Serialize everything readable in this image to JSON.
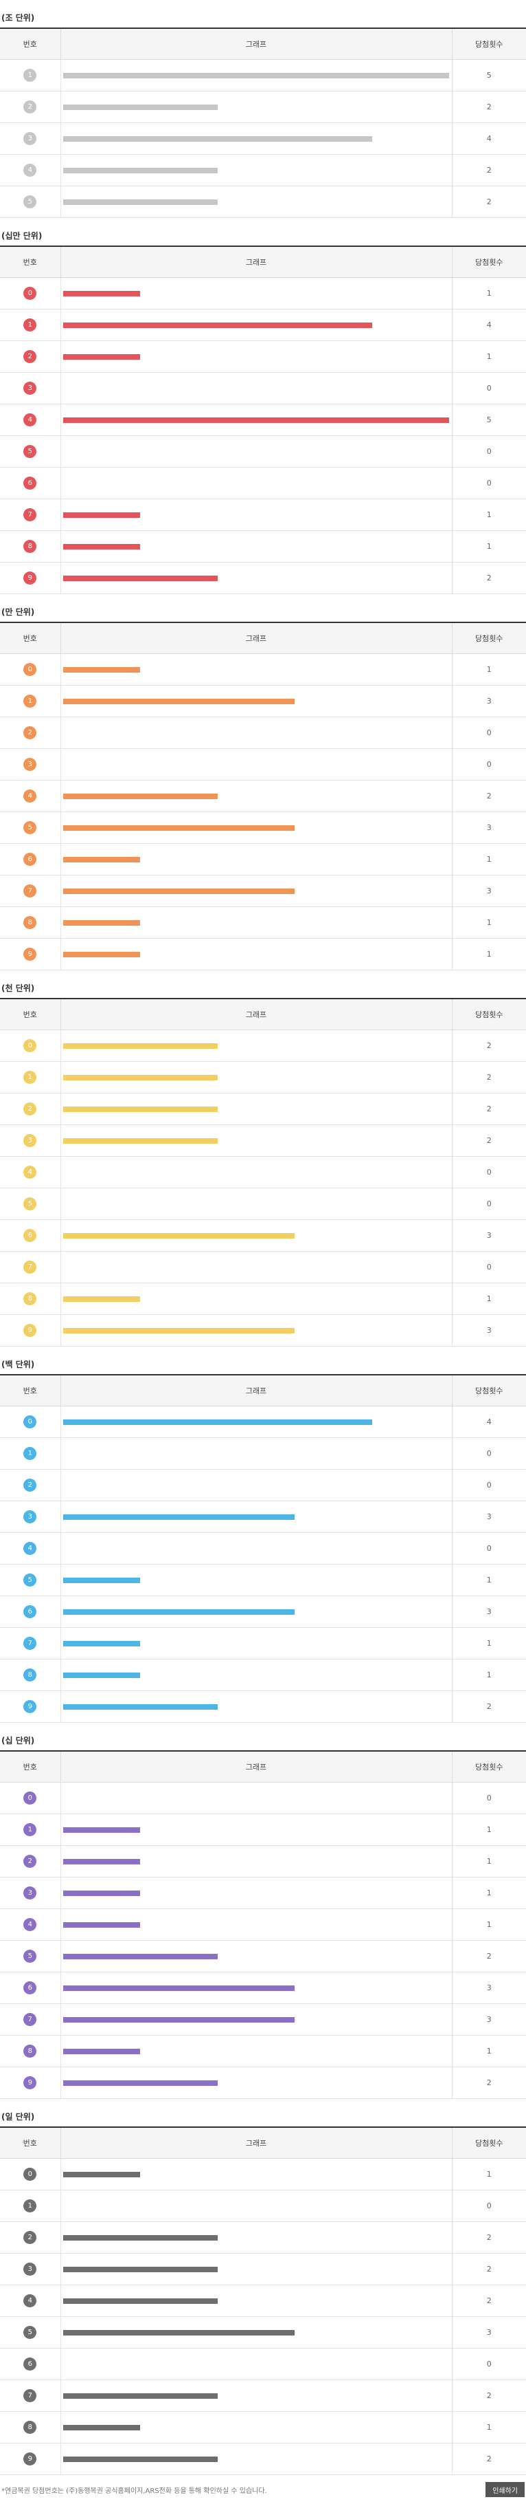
{
  "headers": {
    "number": "번호",
    "graph": "그래프",
    "count": "당첨횟수"
  },
  "max_count": 5,
  "sections": [
    {
      "title": "(조 단위)",
      "color": "#c6c6c6",
      "rows": [
        {
          "num": "1",
          "count": 5
        },
        {
          "num": "2",
          "count": 2
        },
        {
          "num": "3",
          "count": 4
        },
        {
          "num": "4",
          "count": 2
        },
        {
          "num": "5",
          "count": 2
        }
      ]
    },
    {
      "title": "(십만 단위)",
      "color": "#e5545a",
      "rows": [
        {
          "num": "0",
          "count": 1
        },
        {
          "num": "1",
          "count": 4
        },
        {
          "num": "2",
          "count": 1
        },
        {
          "num": "3",
          "count": 0
        },
        {
          "num": "4",
          "count": 5
        },
        {
          "num": "5",
          "count": 0
        },
        {
          "num": "6",
          "count": 0
        },
        {
          "num": "7",
          "count": 1
        },
        {
          "num": "8",
          "count": 1
        },
        {
          "num": "9",
          "count": 2
        }
      ]
    },
    {
      "title": "(만 단위)",
      "color": "#ef9455",
      "rows": [
        {
          "num": "0",
          "count": 1
        },
        {
          "num": "1",
          "count": 3
        },
        {
          "num": "2",
          "count": 0
        },
        {
          "num": "3",
          "count": 0
        },
        {
          "num": "4",
          "count": 2
        },
        {
          "num": "5",
          "count": 3
        },
        {
          "num": "6",
          "count": 1
        },
        {
          "num": "7",
          "count": 3
        },
        {
          "num": "8",
          "count": 1
        },
        {
          "num": "9",
          "count": 1
        }
      ]
    },
    {
      "title": "(천 단위)",
      "color": "#f2cf61",
      "rows": [
        {
          "num": "0",
          "count": 2
        },
        {
          "num": "1",
          "count": 2
        },
        {
          "num": "2",
          "count": 2
        },
        {
          "num": "3",
          "count": 2
        },
        {
          "num": "4",
          "count": 0
        },
        {
          "num": "5",
          "count": 0
        },
        {
          "num": "6",
          "count": 3
        },
        {
          "num": "7",
          "count": 0
        },
        {
          "num": "8",
          "count": 1
        },
        {
          "num": "9",
          "count": 3
        }
      ]
    },
    {
      "title": "(백 단위)",
      "color": "#4db4e8",
      "rows": [
        {
          "num": "0",
          "count": 4
        },
        {
          "num": "1",
          "count": 0
        },
        {
          "num": "2",
          "count": 0
        },
        {
          "num": "3",
          "count": 3
        },
        {
          "num": "4",
          "count": 0
        },
        {
          "num": "5",
          "count": 1
        },
        {
          "num": "6",
          "count": 3
        },
        {
          "num": "7",
          "count": 1
        },
        {
          "num": "8",
          "count": 1
        },
        {
          "num": "9",
          "count": 2
        }
      ]
    },
    {
      "title": "(십 단위)",
      "color": "#8b6fc6",
      "rows": [
        {
          "num": "0",
          "count": 0
        },
        {
          "num": "1",
          "count": 1
        },
        {
          "num": "2",
          "count": 1
        },
        {
          "num": "3",
          "count": 1
        },
        {
          "num": "4",
          "count": 1
        },
        {
          "num": "5",
          "count": 2
        },
        {
          "num": "6",
          "count": 3
        },
        {
          "num": "7",
          "count": 3
        },
        {
          "num": "8",
          "count": 1
        },
        {
          "num": "9",
          "count": 2
        }
      ]
    },
    {
      "title": "(일 단위)",
      "color": "#6e6e6e",
      "rows": [
        {
          "num": "0",
          "count": 1
        },
        {
          "num": "1",
          "count": 0
        },
        {
          "num": "2",
          "count": 2
        },
        {
          "num": "3",
          "count": 2
        },
        {
          "num": "4",
          "count": 2
        },
        {
          "num": "5",
          "count": 3
        },
        {
          "num": "6",
          "count": 0
        },
        {
          "num": "7",
          "count": 2
        },
        {
          "num": "8",
          "count": 1
        },
        {
          "num": "9",
          "count": 2
        }
      ]
    }
  ],
  "footer": {
    "note": "*연금복권 당첨번호는 (주)동행복권 공식홈페이지,ARS전화 등을 통해 확인하실 수 있습니다.",
    "print_label": "인쇄하기"
  }
}
